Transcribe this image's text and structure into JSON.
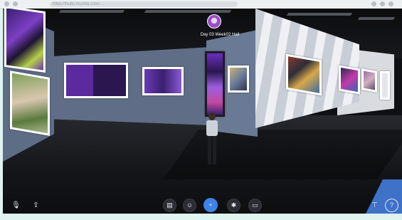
{
  "browser": {
    "url": "https://hubs.mozilla.com/..."
  },
  "room": {
    "title": "Day 03 Week02 Hall"
  },
  "toolbar": {
    "left": [
      {
        "name": "mic-toggle-button",
        "icon": "mic-icon",
        "glyph": "🎙"
      },
      {
        "name": "share-button",
        "icon": "share-icon",
        "glyph": "⇪"
      }
    ],
    "center": [
      {
        "name": "place-button",
        "icon": "place-icon",
        "glyph": "▤"
      },
      {
        "name": "react-button",
        "icon": "react-icon",
        "glyph": "☺"
      },
      {
        "name": "main-action-button",
        "icon": "plus-icon",
        "glyph": "+"
      },
      {
        "name": "more-button",
        "icon": "more-icon",
        "glyph": "✱"
      },
      {
        "name": "chat-button",
        "icon": "chat-icon",
        "glyph": "▭"
      }
    ],
    "right": [
      {
        "name": "pin-button",
        "icon": "pin-icon",
        "glyph": "⊤"
      },
      {
        "name": "help-button",
        "icon": "help-icon",
        "glyph": "?"
      }
    ]
  },
  "colors": {
    "accent": "#3e83ea",
    "wall": "#5f6e86",
    "floor": "#131518",
    "art_purple": "#5b2a9c"
  }
}
